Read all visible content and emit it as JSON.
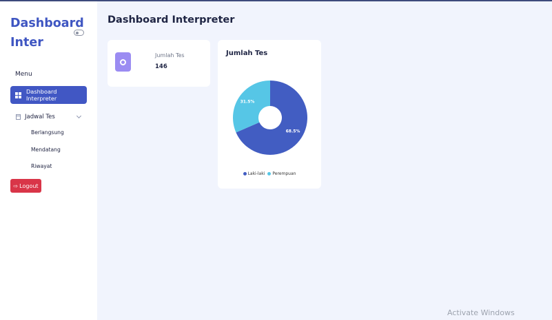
{
  "sidebar": {
    "brand": "Dashboard Inter",
    "menu_label": "Menu",
    "nav_active_label": "Dashboard Interpreter",
    "nav_jadwal_label": "Jadwal Tes",
    "sub_items": [
      "Berlangsung",
      "Mendatang",
      "Riwayat"
    ],
    "logout_label": "Logout"
  },
  "header": {
    "title": "Dashboard Interpreter"
  },
  "stat_card": {
    "label": "Jumlah Tes",
    "value": "146"
  },
  "chart_card": {
    "title": "Jumlah Tes"
  },
  "chart_data": {
    "type": "pie",
    "title": "Jumlah Tes",
    "donut": true,
    "legend_position": "bottom",
    "categories": [
      "Laki-laki",
      "Perempuan"
    ],
    "values": [
      68.5,
      31.5
    ],
    "labels": [
      "68.5%",
      "31.5%"
    ],
    "colors": [
      "#425dc2",
      "#56c6e6"
    ]
  },
  "colors": {
    "primary": "#4157c4",
    "logout": "#d93548",
    "background": "#f1f4fd"
  },
  "watermark": "Activate Windows"
}
